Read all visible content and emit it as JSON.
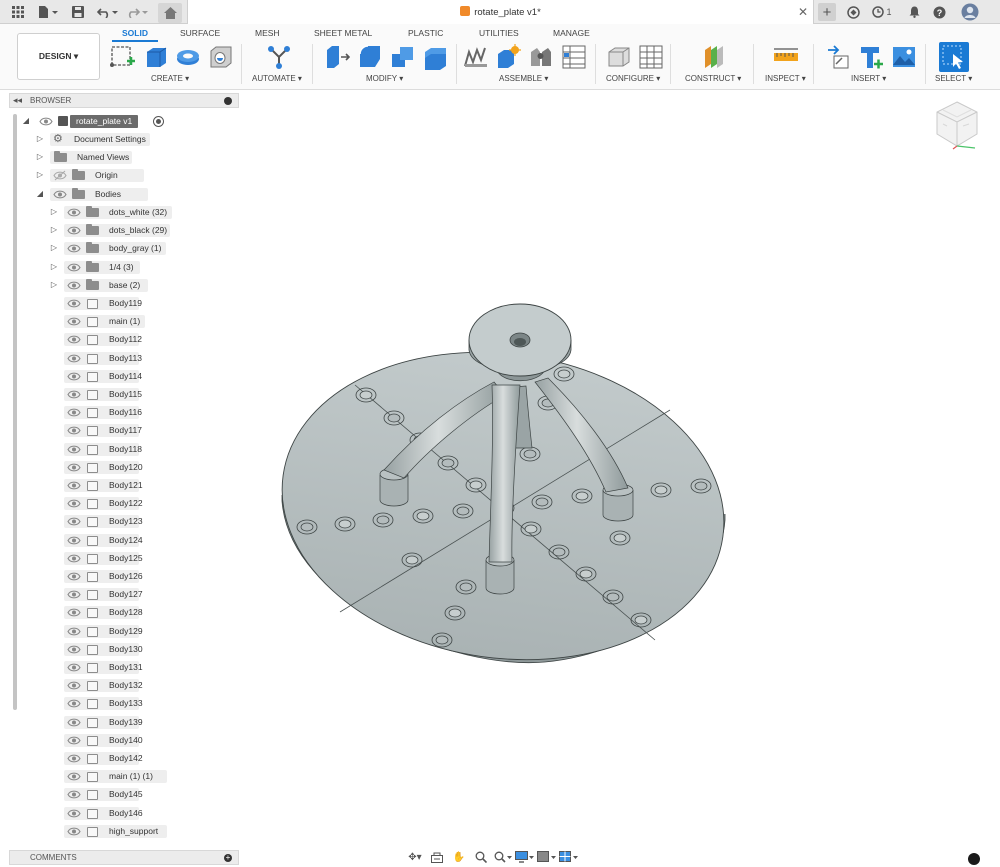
{
  "document": {
    "title": "rotate_plate v1*"
  },
  "topbar": {
    "notification_count": "1"
  },
  "workspace": {
    "label": "DESIGN ▾"
  },
  "tabs": [
    {
      "label": "SOLID"
    },
    {
      "label": "SURFACE"
    },
    {
      "label": "MESH"
    },
    {
      "label": "SHEET METAL"
    },
    {
      "label": "PLASTIC"
    },
    {
      "label": "UTILITIES"
    },
    {
      "label": "MANAGE"
    }
  ],
  "groups": [
    {
      "label": "CREATE ▾"
    },
    {
      "label": "AUTOMATE ▾"
    },
    {
      "label": "MODIFY ▾"
    },
    {
      "label": "ASSEMBLE ▾"
    },
    {
      "label": "CONFIGURE ▾"
    },
    {
      "label": "CONSTRUCT ▾"
    },
    {
      "label": "INSPECT ▾"
    },
    {
      "label": "INSERT ▾"
    },
    {
      "label": "SELECT ▾"
    }
  ],
  "browser": {
    "title": "BROWSER",
    "root": {
      "label": "rotate_plate v1"
    },
    "items": [
      {
        "label": "Document Settings"
      },
      {
        "label": "Named Views"
      },
      {
        "label": "Origin"
      },
      {
        "label": "Bodies"
      }
    ],
    "folders": [
      {
        "label": "dots_white (32)"
      },
      {
        "label": "dots_black (29)"
      },
      {
        "label": "body_gray (1)"
      },
      {
        "label": "1/4 (3)"
      },
      {
        "label": "base (2)"
      }
    ],
    "bodies": [
      "Body119",
      "main (1)",
      "Body112",
      "Body113",
      "Body114",
      "Body115",
      "Body116",
      "Body117",
      "Body118",
      "Body120",
      "Body121",
      "Body122",
      "Body123",
      "Body124",
      "Body125",
      "Body126",
      "Body127",
      "Body128",
      "Body129",
      "Body130",
      "Body131",
      "Body132",
      "Body133",
      "Body139",
      "Body140",
      "Body142",
      "main (1) (1)",
      "Body145",
      "Body146",
      "high_support"
    ]
  },
  "comments": {
    "title": "COMMENTS"
  },
  "colors": {
    "accent": "#1a7ad4",
    "model_fill": "#b8c1c2",
    "model_edge": "#3d4444"
  }
}
